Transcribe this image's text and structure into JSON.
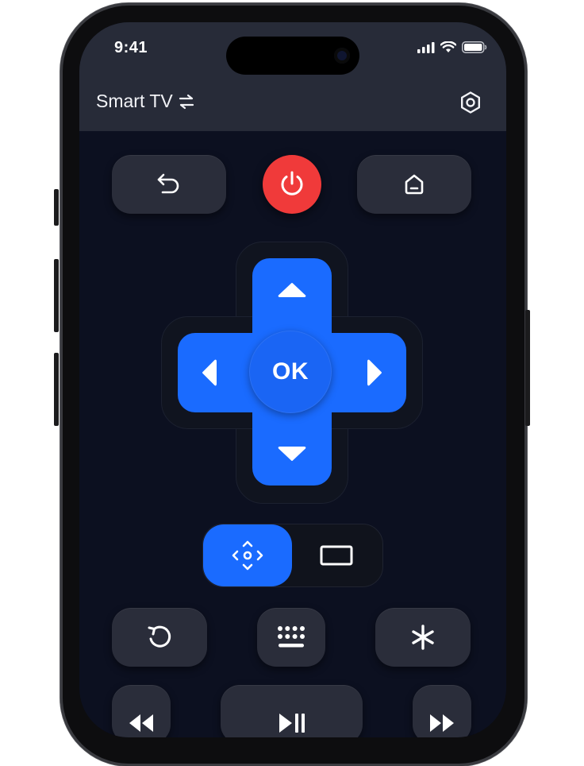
{
  "status_bar": {
    "time": "9:41"
  },
  "header": {
    "title": "Smart TV"
  },
  "remote": {
    "ok_label": "OK"
  },
  "icons": {
    "back": "back-arrow-icon",
    "power": "power-icon",
    "home": "home-icon",
    "up": "triangle-up-icon",
    "down": "triangle-down-icon",
    "left": "triangle-left-icon",
    "right": "triangle-right-icon",
    "dpad_mode": "dpad-mode-icon",
    "touchpad_mode": "touchpad-mode-icon",
    "replay": "replay-icon",
    "keyboard": "keyboard-icon",
    "options": "asterisk-icon",
    "rewind": "rewind-icon",
    "play_pause": "play-pause-icon",
    "fast_forward": "fast-forward-icon",
    "settings": "gear-icon",
    "switch": "switch-arrows-icon"
  },
  "mode_toggle": {
    "selected": "dpad"
  },
  "colors": {
    "accent": "#1a6bff",
    "power": "#f03a3a",
    "background": "#0c1020",
    "header": "#272b38",
    "button": "#2a2d3a"
  }
}
